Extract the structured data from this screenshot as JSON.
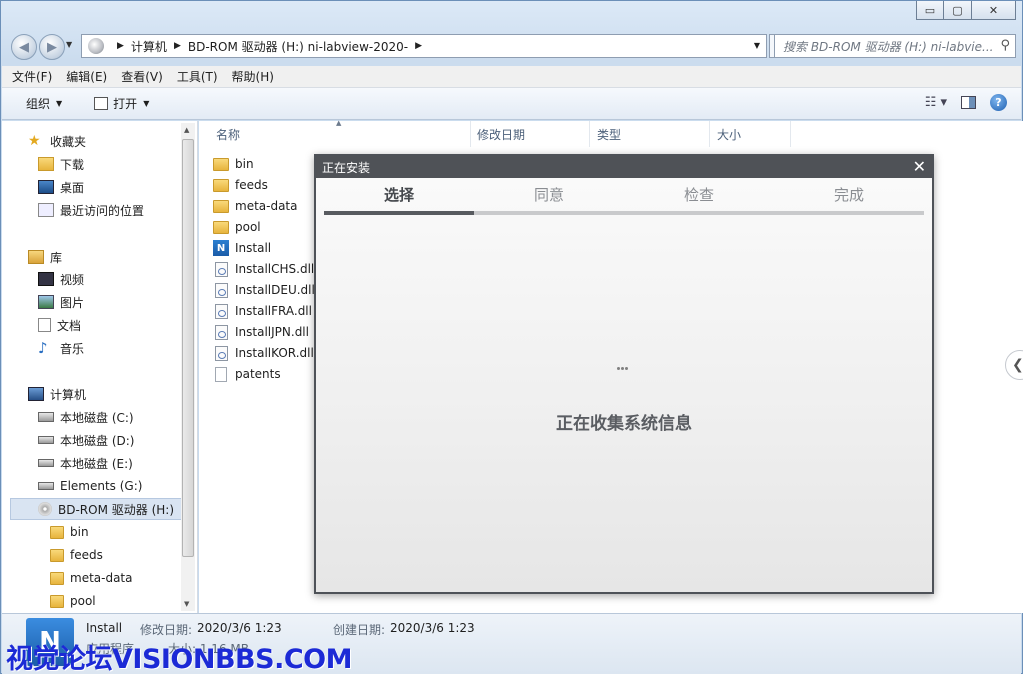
{
  "window": {
    "caption_buttons": {
      "minimize": "▭",
      "maximize": "▢",
      "close": "✕"
    }
  },
  "nav": {
    "breadcrumbs": [
      "计算机",
      "BD-ROM 驱动器 (H:) ni-labview-2020-"
    ],
    "search_placeholder": "搜索 BD-ROM 驱动器 (H:) ni-labvie..."
  },
  "menubar": [
    "文件(F)",
    "编辑(E)",
    "查看(V)",
    "工具(T)",
    "帮助(H)"
  ],
  "toolbar": {
    "organize": "组织",
    "open": "打开"
  },
  "navpane": {
    "favorites": {
      "label": "收藏夹",
      "items": [
        "下载",
        "桌面",
        "最近访问的位置"
      ]
    },
    "libraries": {
      "label": "库",
      "items": [
        "视频",
        "图片",
        "文档",
        "音乐"
      ]
    },
    "computer": {
      "label": "计算机",
      "drives": [
        "本地磁盘 (C:)",
        "本地磁盘 (D:)",
        "本地磁盘 (E:)",
        "Elements (G:)",
        "BD-ROM 驱动器 (H:)"
      ],
      "subfolders": [
        "bin",
        "feeds",
        "meta-data",
        "pool"
      ]
    }
  },
  "filelist": {
    "columns": [
      "名称",
      "修改日期",
      "类型",
      "大小"
    ],
    "files": [
      {
        "name": "bin",
        "kind": "folder"
      },
      {
        "name": "feeds",
        "kind": "folder"
      },
      {
        "name": "meta-data",
        "kind": "folder"
      },
      {
        "name": "pool",
        "kind": "folder"
      },
      {
        "name": "Install",
        "kind": "app"
      },
      {
        "name": "InstallCHS.dll",
        "kind": "dll"
      },
      {
        "name": "InstallDEU.dll",
        "kind": "dll"
      },
      {
        "name": "InstallFRA.dll",
        "kind": "dll"
      },
      {
        "name": "InstallJPN.dll",
        "kind": "dll"
      },
      {
        "name": "InstallKOR.dll",
        "kind": "dll"
      },
      {
        "name": "patents",
        "kind": "text"
      }
    ]
  },
  "dialog": {
    "title": "正在安装",
    "close": "✕",
    "steps": [
      "选择",
      "同意",
      "检查",
      "完成"
    ],
    "active_step": 0,
    "progress_fraction": 0.25,
    "status": "正在收集系统信息"
  },
  "details": {
    "name": "Install",
    "modified_label": "修改日期:",
    "modified_value": "2020/3/6 1:23",
    "created_label": "创建日期:",
    "created_value": "2020/3/6 1:23",
    "type_partial": "应用程序",
    "size_partial": "大小: 1.16 MB"
  },
  "watermark": "视觉论坛VISIONBBS.COM",
  "colors": {
    "dialog_title": "#4f5257",
    "watermark": "#1c2ad6",
    "step_fill": "#585b60"
  }
}
